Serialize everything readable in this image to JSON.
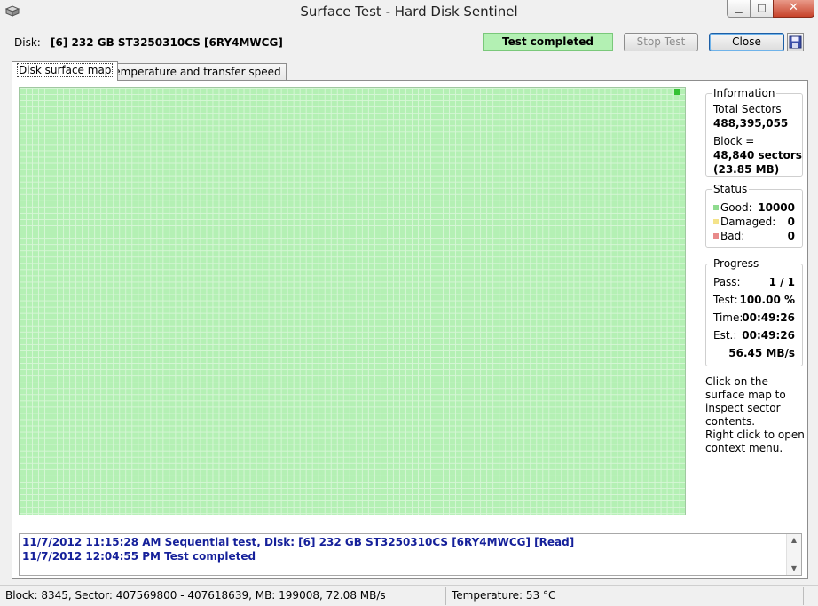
{
  "window": {
    "title": "Surface Test - Hard Disk Sentinel",
    "minimize_glyph": "▁",
    "maximize_glyph": "□",
    "close_glyph": "✕"
  },
  "toolbar": {
    "disk_label": "Disk:",
    "disk_name": "[6] 232 GB  ST3250310CS [6RY4MWCG]",
    "status_text": "Test completed",
    "status_color": "#b3f0b3",
    "stop_button": "Stop Test",
    "close_button": "Close",
    "save_icon": "floppy-disk-icon"
  },
  "tabs": [
    {
      "label": "Disk surface map",
      "active": true
    },
    {
      "label": "Temperature and transfer speed",
      "active": false
    }
  ],
  "surface_map": {
    "good_color": "#b4f0b4",
    "block_count": 10000
  },
  "information": {
    "title": "Information",
    "total_sectors_label": "Total Sectors",
    "total_sectors_value": "488,395,055",
    "block_label": "Block =",
    "block_sectors": "48,840 sectors",
    "block_size": "(23.85 MB)"
  },
  "status": {
    "title": "Status",
    "good_label": "Good:",
    "good_value": "10000",
    "good_color": "#8fdb8f",
    "damaged_label": "Damaged:",
    "damaged_value": "0",
    "damaged_color": "#f4e38a",
    "bad_label": "Bad:",
    "bad_value": "0",
    "bad_color": "#e88a8a"
  },
  "progress": {
    "title": "Progress",
    "pass_label": "Pass:",
    "pass_value": "1 / 1",
    "test_label": "Test:",
    "test_value": "100.00 %",
    "time_label": "Time:",
    "time_value": "00:49:26",
    "est_label": "Est.:",
    "est_value": "00:49:26",
    "speed_value": "56.45 MB/s"
  },
  "hints": {
    "click_hint": "Click on the surface map to inspect sector contents.",
    "right_click_hint": "Right click to open context menu."
  },
  "log": [
    "11/7/2012  11:15:28 AM   Sequential test, Disk: [6] 232 GB  ST3250310CS [6RY4MWCG] [Read]",
    "11/7/2012  12:04:55 PM   Test completed"
  ],
  "statusbar": {
    "left": "Block: 8345, Sector: 407569800 - 407618639, MB: 199008, 72.08 MB/s",
    "right": "Temperature: 53  °C"
  }
}
